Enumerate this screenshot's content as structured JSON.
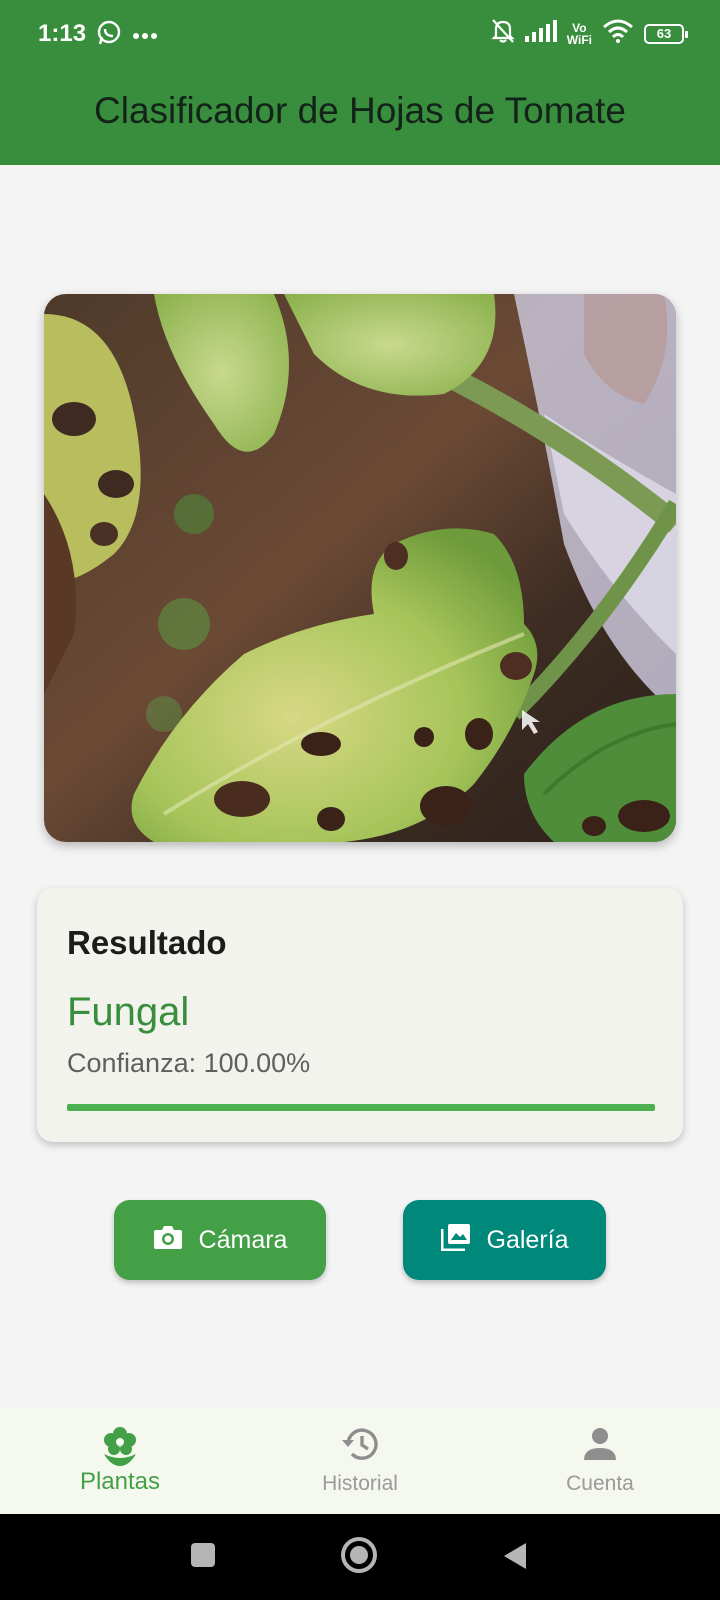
{
  "status_bar": {
    "time": "1:13",
    "volte_top": "Vo",
    "volte_bottom": "WiFi",
    "battery": "63"
  },
  "app_bar": {
    "title": "Clasificador de Hojas de Tomate"
  },
  "result": {
    "heading": "Resultado",
    "class_label": "Fungal",
    "confidence_text": "Confianza: 100.00%",
    "confidence_value": 1.0
  },
  "buttons": {
    "camera_label": "Cámara",
    "gallery_label": "Galería"
  },
  "bottom_nav": {
    "items": [
      {
        "label": "Plantas",
        "icon": "flower-icon",
        "active": true
      },
      {
        "label": "Historial",
        "icon": "history-icon",
        "active": false
      },
      {
        "label": "Cuenta",
        "icon": "person-icon",
        "active": false
      }
    ]
  },
  "colors": {
    "primary": "#388e3c",
    "camera_button": "#43a047",
    "gallery_button": "#00897b",
    "progress": "#4caf50",
    "active_nav": "#43a047"
  }
}
